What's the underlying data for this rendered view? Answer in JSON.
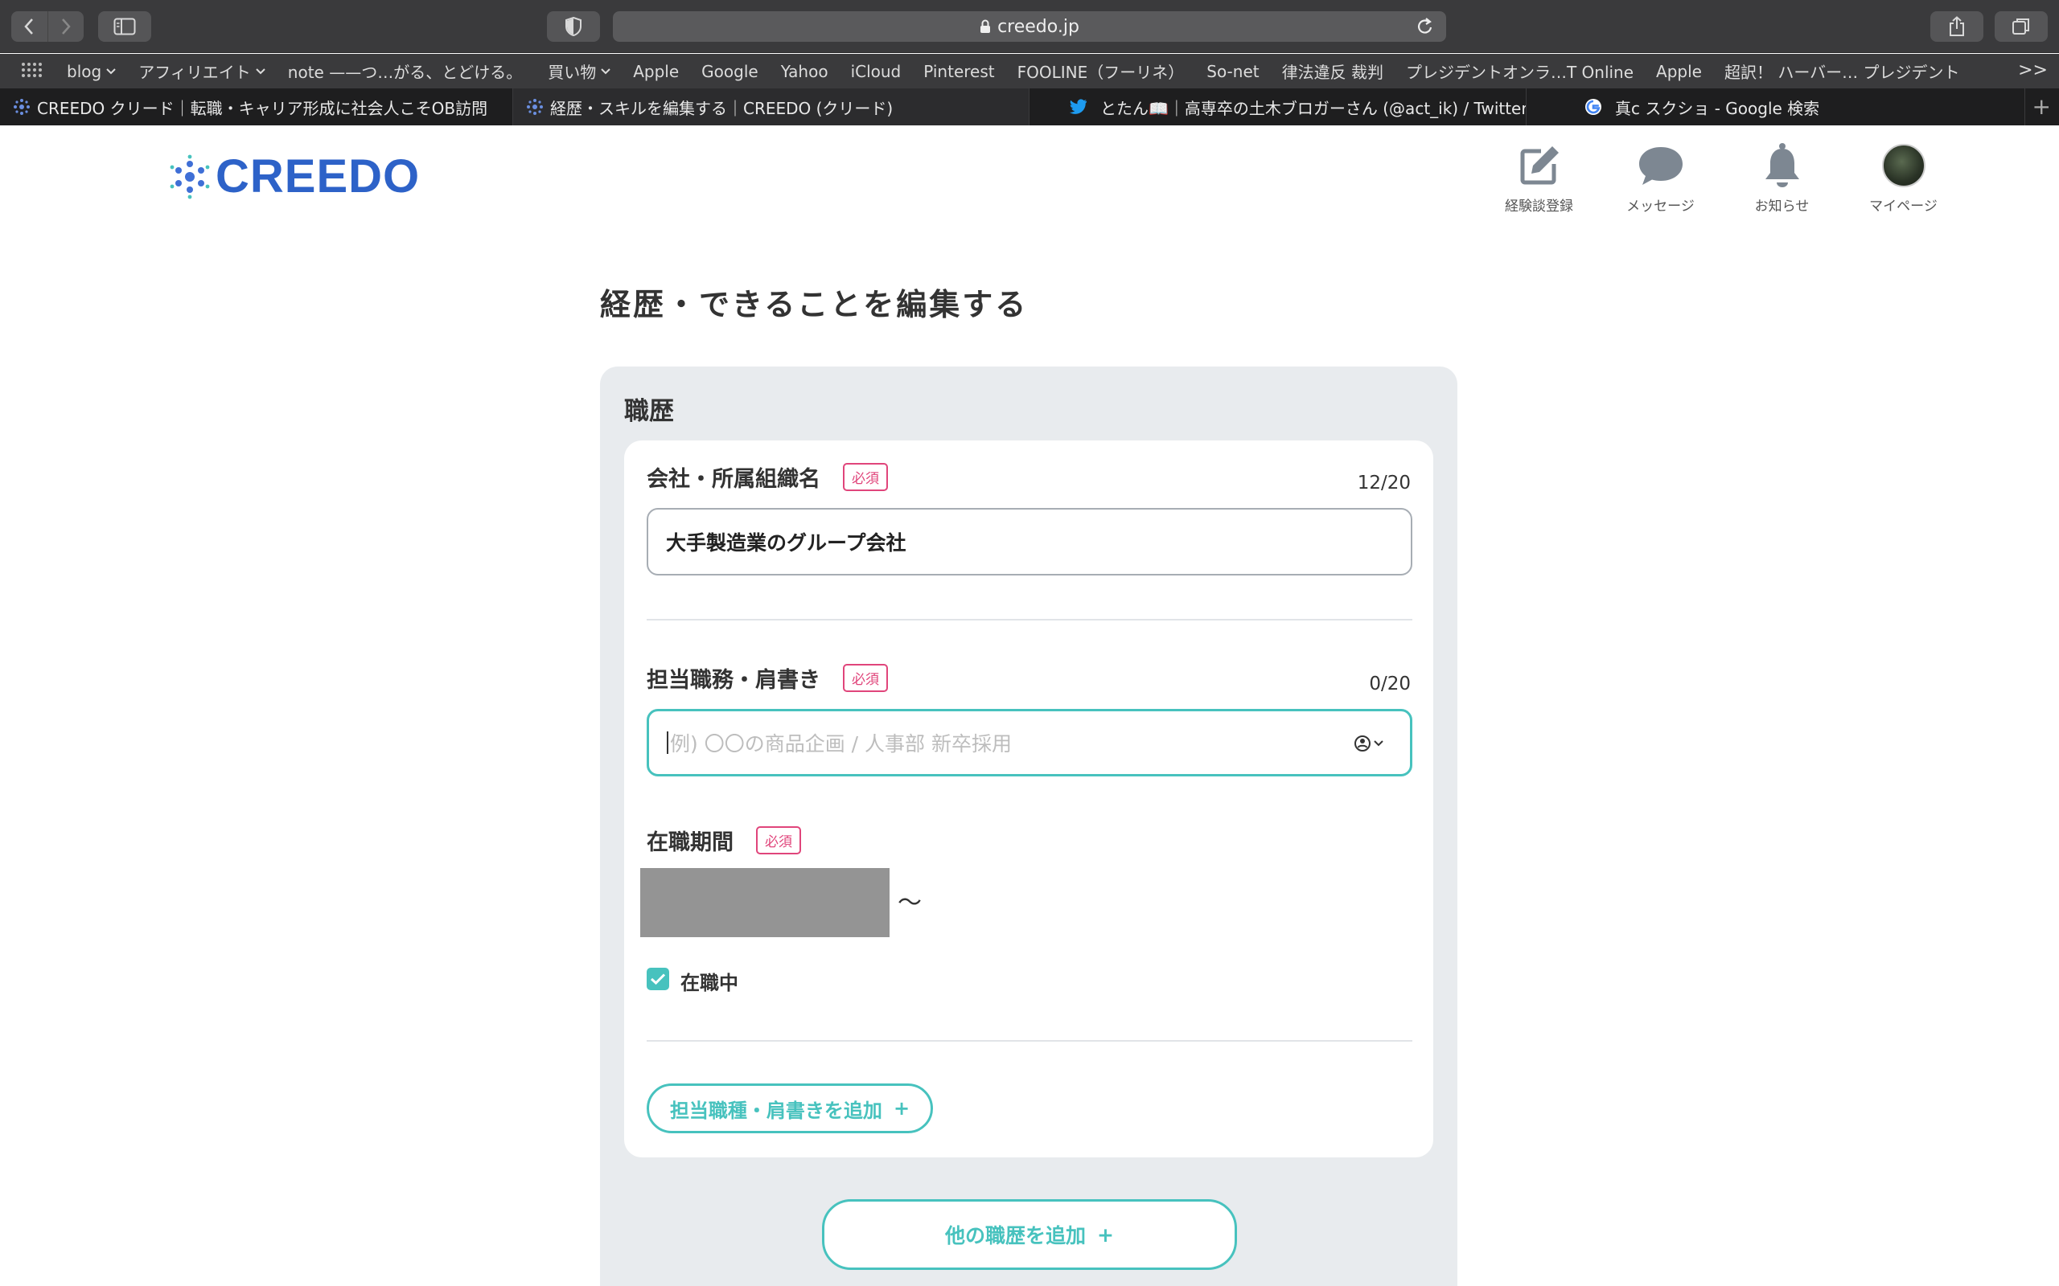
{
  "browser": {
    "url": "creedo.jp",
    "bookmarks": [
      "blog",
      "アフィリエイト",
      "note ——つ…がる、とどける。",
      "買い物",
      "Apple",
      "Google",
      "Yahoo",
      "iCloud",
      "Pinterest",
      "FOOLINE（フーリネ）",
      "So-net",
      "律法違反 裁判",
      "プレジデントオンラ…T Online",
      "Apple",
      "超訳！ ハーバー… プレジデント"
    ],
    "tabs": [
      {
        "title": "CREEDO クリード｜転職・キャリア形成に社会人こそOB訪問"
      },
      {
        "title": "経歴・スキルを編集する｜CREEDO (クリード)"
      },
      {
        "title": "とたん📖｜高専卒の土木ブロガーさん (@act_ik) / Twitter"
      },
      {
        "title": "真c スクショ - Google 検索"
      }
    ]
  },
  "header": {
    "logo": "CREEDO",
    "nav": [
      {
        "label": "経験談登録",
        "icon": "edit-icon"
      },
      {
        "label": "メッセージ",
        "icon": "message-icon"
      },
      {
        "label": "お知らせ",
        "icon": "bell-icon"
      },
      {
        "label": "マイページ",
        "icon": "avatar"
      }
    ]
  },
  "page": {
    "title": "経歴・できることを編集する",
    "section_title": "職歴",
    "required_badge": "必須",
    "company": {
      "label": "会社・所属組織名",
      "counter": "12/20",
      "value": "大手製造業のグループ会社"
    },
    "role": {
      "label": "担当職務・肩書き",
      "counter": "0/20",
      "placeholder": "例) 〇〇の商品企画 / 人事部 新卒採用"
    },
    "period": {
      "label": "在職期間",
      "separator": "〜",
      "current_label": "在職中",
      "current_checked": true
    },
    "add_role_button": "担当職種・肩書きを追加",
    "add_career_button": "他の職歴を追加",
    "plus": "+"
  },
  "colors": {
    "accent": "#47c2be",
    "required": "#e0457b",
    "brand": "#2d62c8"
  }
}
